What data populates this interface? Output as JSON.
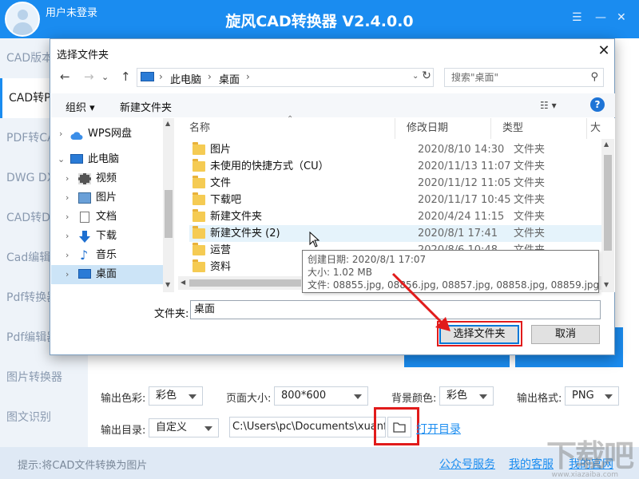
{
  "app": {
    "title": "旋风CAD转换器 V2.4.0.0",
    "user_label": "用户未登录",
    "header_icons": [
      "settings-icon",
      "minimize-icon",
      "close-icon"
    ]
  },
  "sidebar": {
    "items": [
      {
        "label": "CAD版本转换"
      },
      {
        "label": "CAD转PDF"
      },
      {
        "label": "PDF转CAD"
      },
      {
        "label": "DWG DXF互转"
      },
      {
        "label": "CAD转DWF"
      },
      {
        "label": "Cad编辑器"
      },
      {
        "label": "Pdf转换器"
      },
      {
        "label": "Pdf编辑器"
      },
      {
        "label": "图片转换器"
      },
      {
        "label": "图文识别"
      }
    ],
    "active_index": 1
  },
  "options": {
    "color_label": "输出色彩:",
    "color_value": "彩色",
    "page_size_label": "页面大小:",
    "page_size_value": "800*600",
    "bg_color_label": "背景颜色:",
    "bg_color_value": "彩色",
    "format_label": "输出格式:",
    "format_value": "PNG",
    "output_dir_label": "输出目录:",
    "output_dir_mode": "自定义",
    "output_path": "C:\\Users\\pc\\Documents\\xuanfeng",
    "open_dir_link": "打开目录"
  },
  "footer": {
    "tip": "提示:将CAD文件转换为图片",
    "links": [
      "公众号服务",
      "我的客服",
      "我的官网"
    ]
  },
  "watermark": {
    "text": "下载吧",
    "url": "www.xiazaiba.com"
  },
  "dialog": {
    "title": "选择文件夹",
    "breadcrumb": [
      "此电脑",
      "桌面"
    ],
    "search_placeholder": "搜索\"桌面\"",
    "organize_label": "组织 ▾",
    "new_folder_label": "新建文件夹",
    "nav_tree": [
      {
        "label": "WPS网盘",
        "icon": "cloud-icon"
      },
      {
        "label": "此电脑",
        "icon": "computer-icon"
      },
      {
        "label": "视频",
        "icon": "video-icon"
      },
      {
        "label": "图片",
        "icon": "picture-icon"
      },
      {
        "label": "文档",
        "icon": "document-icon"
      },
      {
        "label": "下载",
        "icon": "download-icon"
      },
      {
        "label": "音乐",
        "icon": "music-icon"
      },
      {
        "label": "桌面",
        "icon": "desktop-icon"
      }
    ],
    "columns": {
      "name": "名称",
      "date": "修改日期",
      "type": "类型",
      "size": "大"
    },
    "rows": [
      {
        "name": "图片",
        "date": "2020/8/10 14:30",
        "type": "文件夹"
      },
      {
        "name": "未使用的快捷方式（CU）",
        "date": "2020/11/13 11:07",
        "type": "文件夹"
      },
      {
        "name": "文件",
        "date": "2020/11/12 11:05",
        "type": "文件夹"
      },
      {
        "name": "下载吧",
        "date": "2020/11/17 10:45",
        "type": "文件夹"
      },
      {
        "name": "新建文件夹",
        "date": "2020/4/24 11:15",
        "type": "文件夹"
      },
      {
        "name": "新建文件夹 (2)",
        "date": "2020/8/1 17:41",
        "type": "文件夹"
      },
      {
        "name": "运营",
        "date": "2020/8/6 10:48",
        "type": "文件夹"
      },
      {
        "name": "资料",
        "date": "",
        "type": ""
      }
    ],
    "hover_row_index": 5,
    "tooltip": {
      "created": "创建日期: 2020/8/1 17:07",
      "size": "大小: 1.02 MB",
      "files": "文件: 08855.jpg, 08856.jpg, 08857.jpg, 08858.jpg, 08859.jpg, ..."
    },
    "folder_label": "文件夹:",
    "folder_value": "桌面",
    "select_button": "选择文件夹",
    "cancel_button": "取消"
  },
  "colors": {
    "brand_blue": "#1a8cf0",
    "highlight_red": "#e11b1b"
  }
}
